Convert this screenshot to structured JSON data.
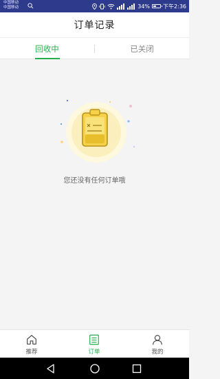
{
  "statusbar": {
    "carrier_line1": "中国移动",
    "carrier_line2": "中国移动",
    "battery_text": "34%",
    "time": "下午2:36",
    "bg_color": "#2e3a8c"
  },
  "header": {
    "title": "订单记录"
  },
  "tabs": [
    {
      "label": "回收中",
      "active": true
    },
    {
      "label": "已关闭",
      "active": false
    }
  ],
  "empty_state": {
    "message": "您还没有任何订单哦",
    "icon": "clipboard-icon"
  },
  "bottom_nav": [
    {
      "label": "推荐",
      "icon": "home-icon",
      "active": false
    },
    {
      "label": "订单",
      "icon": "order-list-icon",
      "active": true
    },
    {
      "label": "我的",
      "icon": "user-icon",
      "active": false
    }
  ],
  "system_nav": [
    "back-icon",
    "home-circle-icon",
    "recent-apps-icon"
  ],
  "colors": {
    "accent": "#22b04b",
    "icon_yellow": "#f5d24a"
  }
}
